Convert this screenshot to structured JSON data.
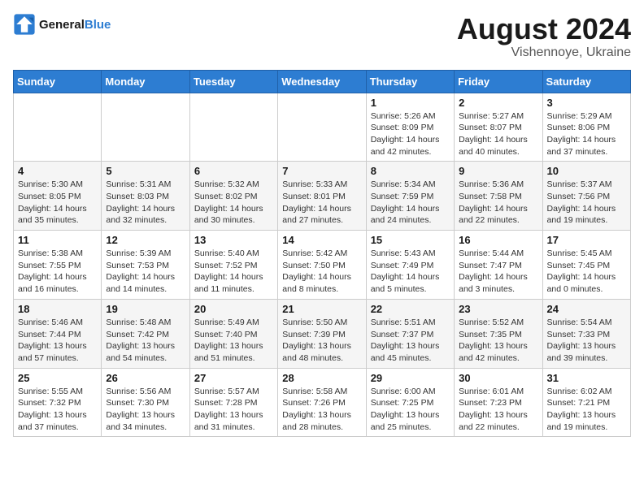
{
  "logo": {
    "line1": "General",
    "line2": "Blue"
  },
  "title": "August 2024",
  "location": "Vishennoye, Ukraine",
  "days_of_week": [
    "Sunday",
    "Monday",
    "Tuesday",
    "Wednesday",
    "Thursday",
    "Friday",
    "Saturday"
  ],
  "weeks": [
    [
      {
        "day": "",
        "info": ""
      },
      {
        "day": "",
        "info": ""
      },
      {
        "day": "",
        "info": ""
      },
      {
        "day": "",
        "info": ""
      },
      {
        "day": "1",
        "info": "Sunrise: 5:26 AM\nSunset: 8:09 PM\nDaylight: 14 hours\nand 42 minutes."
      },
      {
        "day": "2",
        "info": "Sunrise: 5:27 AM\nSunset: 8:07 PM\nDaylight: 14 hours\nand 40 minutes."
      },
      {
        "day": "3",
        "info": "Sunrise: 5:29 AM\nSunset: 8:06 PM\nDaylight: 14 hours\nand 37 minutes."
      }
    ],
    [
      {
        "day": "4",
        "info": "Sunrise: 5:30 AM\nSunset: 8:05 PM\nDaylight: 14 hours\nand 35 minutes."
      },
      {
        "day": "5",
        "info": "Sunrise: 5:31 AM\nSunset: 8:03 PM\nDaylight: 14 hours\nand 32 minutes."
      },
      {
        "day": "6",
        "info": "Sunrise: 5:32 AM\nSunset: 8:02 PM\nDaylight: 14 hours\nand 30 minutes."
      },
      {
        "day": "7",
        "info": "Sunrise: 5:33 AM\nSunset: 8:01 PM\nDaylight: 14 hours\nand 27 minutes."
      },
      {
        "day": "8",
        "info": "Sunrise: 5:34 AM\nSunset: 7:59 PM\nDaylight: 14 hours\nand 24 minutes."
      },
      {
        "day": "9",
        "info": "Sunrise: 5:36 AM\nSunset: 7:58 PM\nDaylight: 14 hours\nand 22 minutes."
      },
      {
        "day": "10",
        "info": "Sunrise: 5:37 AM\nSunset: 7:56 PM\nDaylight: 14 hours\nand 19 minutes."
      }
    ],
    [
      {
        "day": "11",
        "info": "Sunrise: 5:38 AM\nSunset: 7:55 PM\nDaylight: 14 hours\nand 16 minutes."
      },
      {
        "day": "12",
        "info": "Sunrise: 5:39 AM\nSunset: 7:53 PM\nDaylight: 14 hours\nand 14 minutes."
      },
      {
        "day": "13",
        "info": "Sunrise: 5:40 AM\nSunset: 7:52 PM\nDaylight: 14 hours\nand 11 minutes."
      },
      {
        "day": "14",
        "info": "Sunrise: 5:42 AM\nSunset: 7:50 PM\nDaylight: 14 hours\nand 8 minutes."
      },
      {
        "day": "15",
        "info": "Sunrise: 5:43 AM\nSunset: 7:49 PM\nDaylight: 14 hours\nand 5 minutes."
      },
      {
        "day": "16",
        "info": "Sunrise: 5:44 AM\nSunset: 7:47 PM\nDaylight: 14 hours\nand 3 minutes."
      },
      {
        "day": "17",
        "info": "Sunrise: 5:45 AM\nSunset: 7:45 PM\nDaylight: 14 hours\nand 0 minutes."
      }
    ],
    [
      {
        "day": "18",
        "info": "Sunrise: 5:46 AM\nSunset: 7:44 PM\nDaylight: 13 hours\nand 57 minutes."
      },
      {
        "day": "19",
        "info": "Sunrise: 5:48 AM\nSunset: 7:42 PM\nDaylight: 13 hours\nand 54 minutes."
      },
      {
        "day": "20",
        "info": "Sunrise: 5:49 AM\nSunset: 7:40 PM\nDaylight: 13 hours\nand 51 minutes."
      },
      {
        "day": "21",
        "info": "Sunrise: 5:50 AM\nSunset: 7:39 PM\nDaylight: 13 hours\nand 48 minutes."
      },
      {
        "day": "22",
        "info": "Sunrise: 5:51 AM\nSunset: 7:37 PM\nDaylight: 13 hours\nand 45 minutes."
      },
      {
        "day": "23",
        "info": "Sunrise: 5:52 AM\nSunset: 7:35 PM\nDaylight: 13 hours\nand 42 minutes."
      },
      {
        "day": "24",
        "info": "Sunrise: 5:54 AM\nSunset: 7:33 PM\nDaylight: 13 hours\nand 39 minutes."
      }
    ],
    [
      {
        "day": "25",
        "info": "Sunrise: 5:55 AM\nSunset: 7:32 PM\nDaylight: 13 hours\nand 37 minutes."
      },
      {
        "day": "26",
        "info": "Sunrise: 5:56 AM\nSunset: 7:30 PM\nDaylight: 13 hours\nand 34 minutes."
      },
      {
        "day": "27",
        "info": "Sunrise: 5:57 AM\nSunset: 7:28 PM\nDaylight: 13 hours\nand 31 minutes."
      },
      {
        "day": "28",
        "info": "Sunrise: 5:58 AM\nSunset: 7:26 PM\nDaylight: 13 hours\nand 28 minutes."
      },
      {
        "day": "29",
        "info": "Sunrise: 6:00 AM\nSunset: 7:25 PM\nDaylight: 13 hours\nand 25 minutes."
      },
      {
        "day": "30",
        "info": "Sunrise: 6:01 AM\nSunset: 7:23 PM\nDaylight: 13 hours\nand 22 minutes."
      },
      {
        "day": "31",
        "info": "Sunrise: 6:02 AM\nSunset: 7:21 PM\nDaylight: 13 hours\nand 19 minutes."
      }
    ]
  ]
}
